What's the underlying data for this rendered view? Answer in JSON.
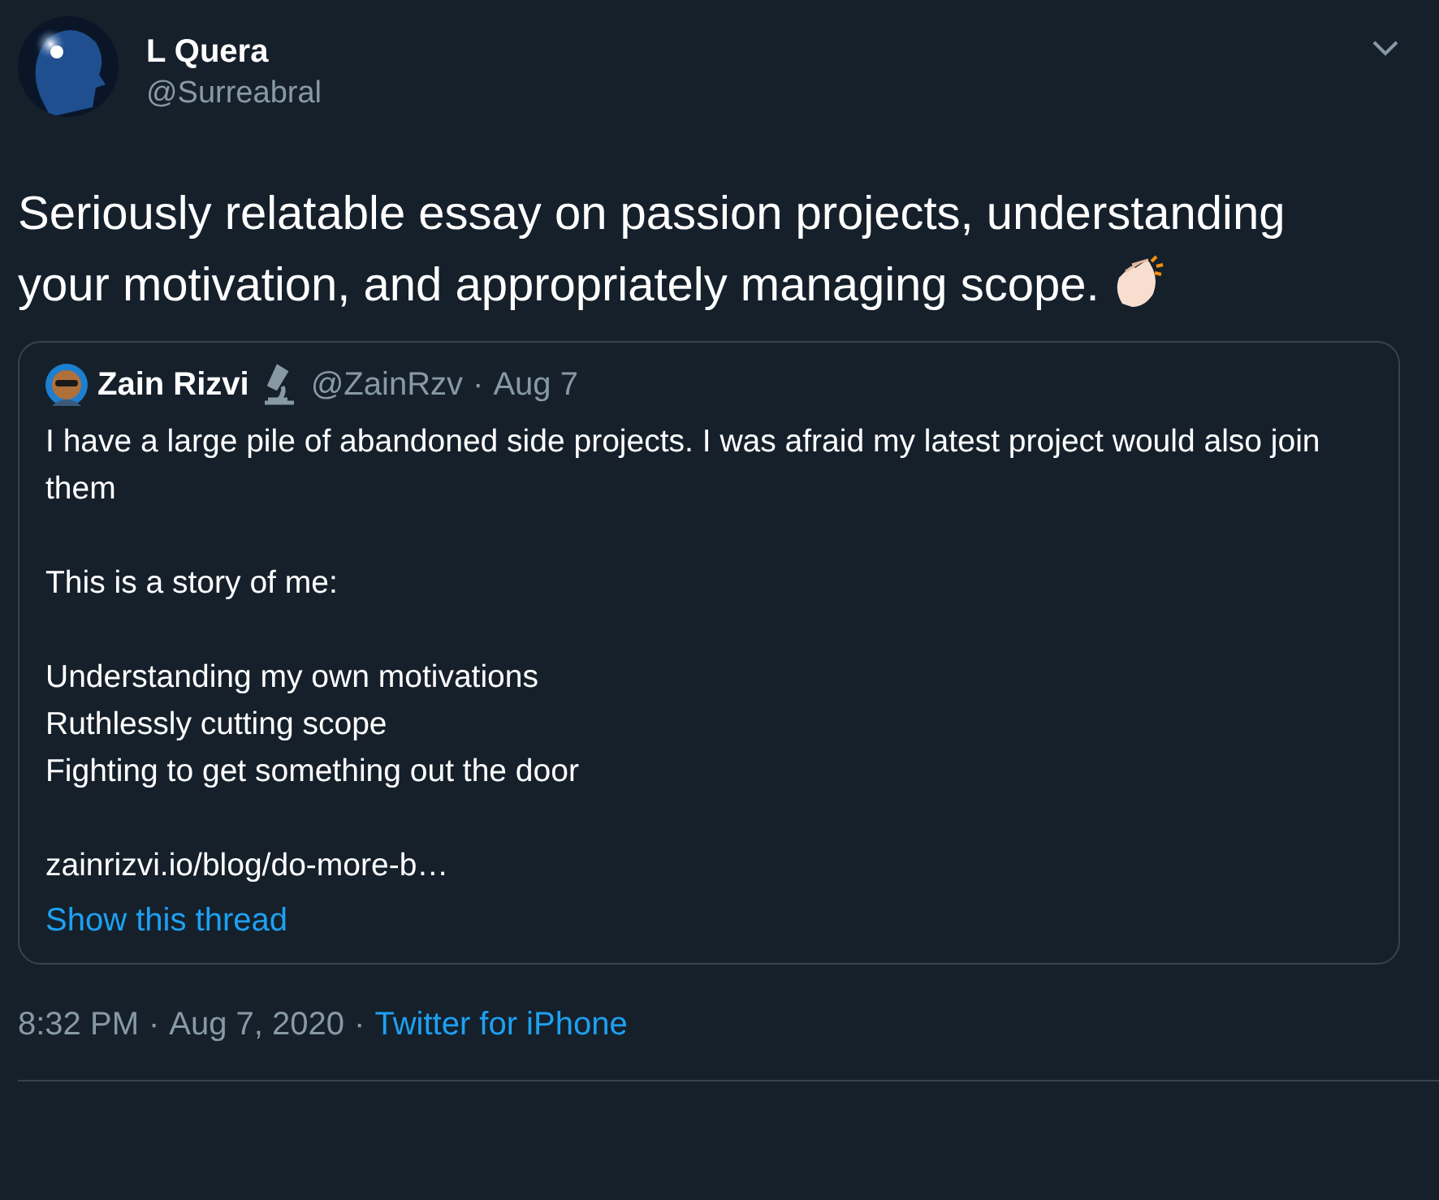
{
  "author": {
    "name": "L Quera",
    "handle": "@Surreabral"
  },
  "tweet_text": "Seriously relatable essay on passion projects, understanding your motivation, and appropriately managing scope.",
  "quoted": {
    "name": "Zain Rizvi",
    "handle": "@ZainRzv",
    "separator": "·",
    "date": "Aug 7",
    "paragraphs": [
      {
        "lines": [
          "I have a large pile of abandoned side projects. I was afraid my latest project would also join them"
        ]
      },
      {
        "lines": [
          "This is a story of me:"
        ]
      },
      {
        "lines": [
          "Understanding my own motivations",
          "Ruthlessly cutting scope",
          "Fighting to get something out the door"
        ]
      },
      {
        "lines": [
          "zainrizvi.io/blog/do-more-b…"
        ]
      }
    ],
    "thread_link": "Show this thread"
  },
  "meta": {
    "time": "8:32 PM",
    "separator_1": "·",
    "date": "Aug 7, 2020",
    "separator_2": "·",
    "source": "Twitter for iPhone"
  }
}
